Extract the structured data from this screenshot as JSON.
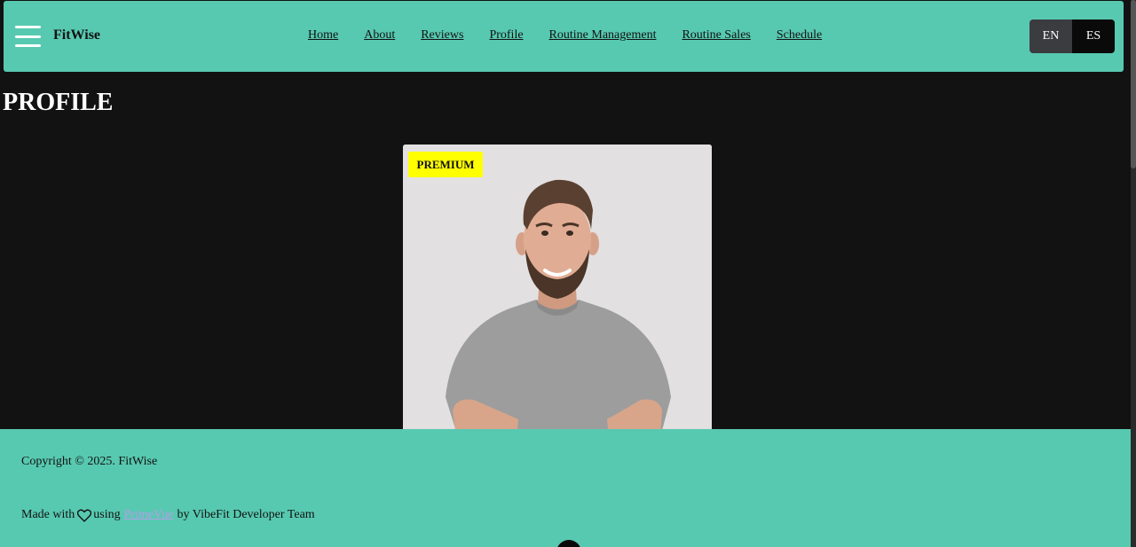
{
  "header": {
    "brand": "FitWise",
    "nav": [
      "Home",
      "About",
      "Reviews",
      "Profile",
      "Routine Management",
      "Routine Sales",
      "Schedule"
    ],
    "languages": [
      "EN",
      "ES"
    ]
  },
  "main": {
    "title": "PROFILE",
    "card": {
      "badge": "PREMIUM"
    }
  },
  "footer": {
    "copyright": "Copyright © 2025. FitWise",
    "made_with_prefix": "Made with",
    "made_with_using": "using",
    "link": "PrimeVue",
    "made_with_suffix": "by VibeFit Developer Team"
  },
  "colors": {
    "header_bg": "#57c9b0",
    "badge_bg": "#ffff00",
    "page_bg": "#121212",
    "link": "#b59ee8"
  },
  "icons": [
    "hamburger-menu-icon",
    "heart-icon"
  ]
}
